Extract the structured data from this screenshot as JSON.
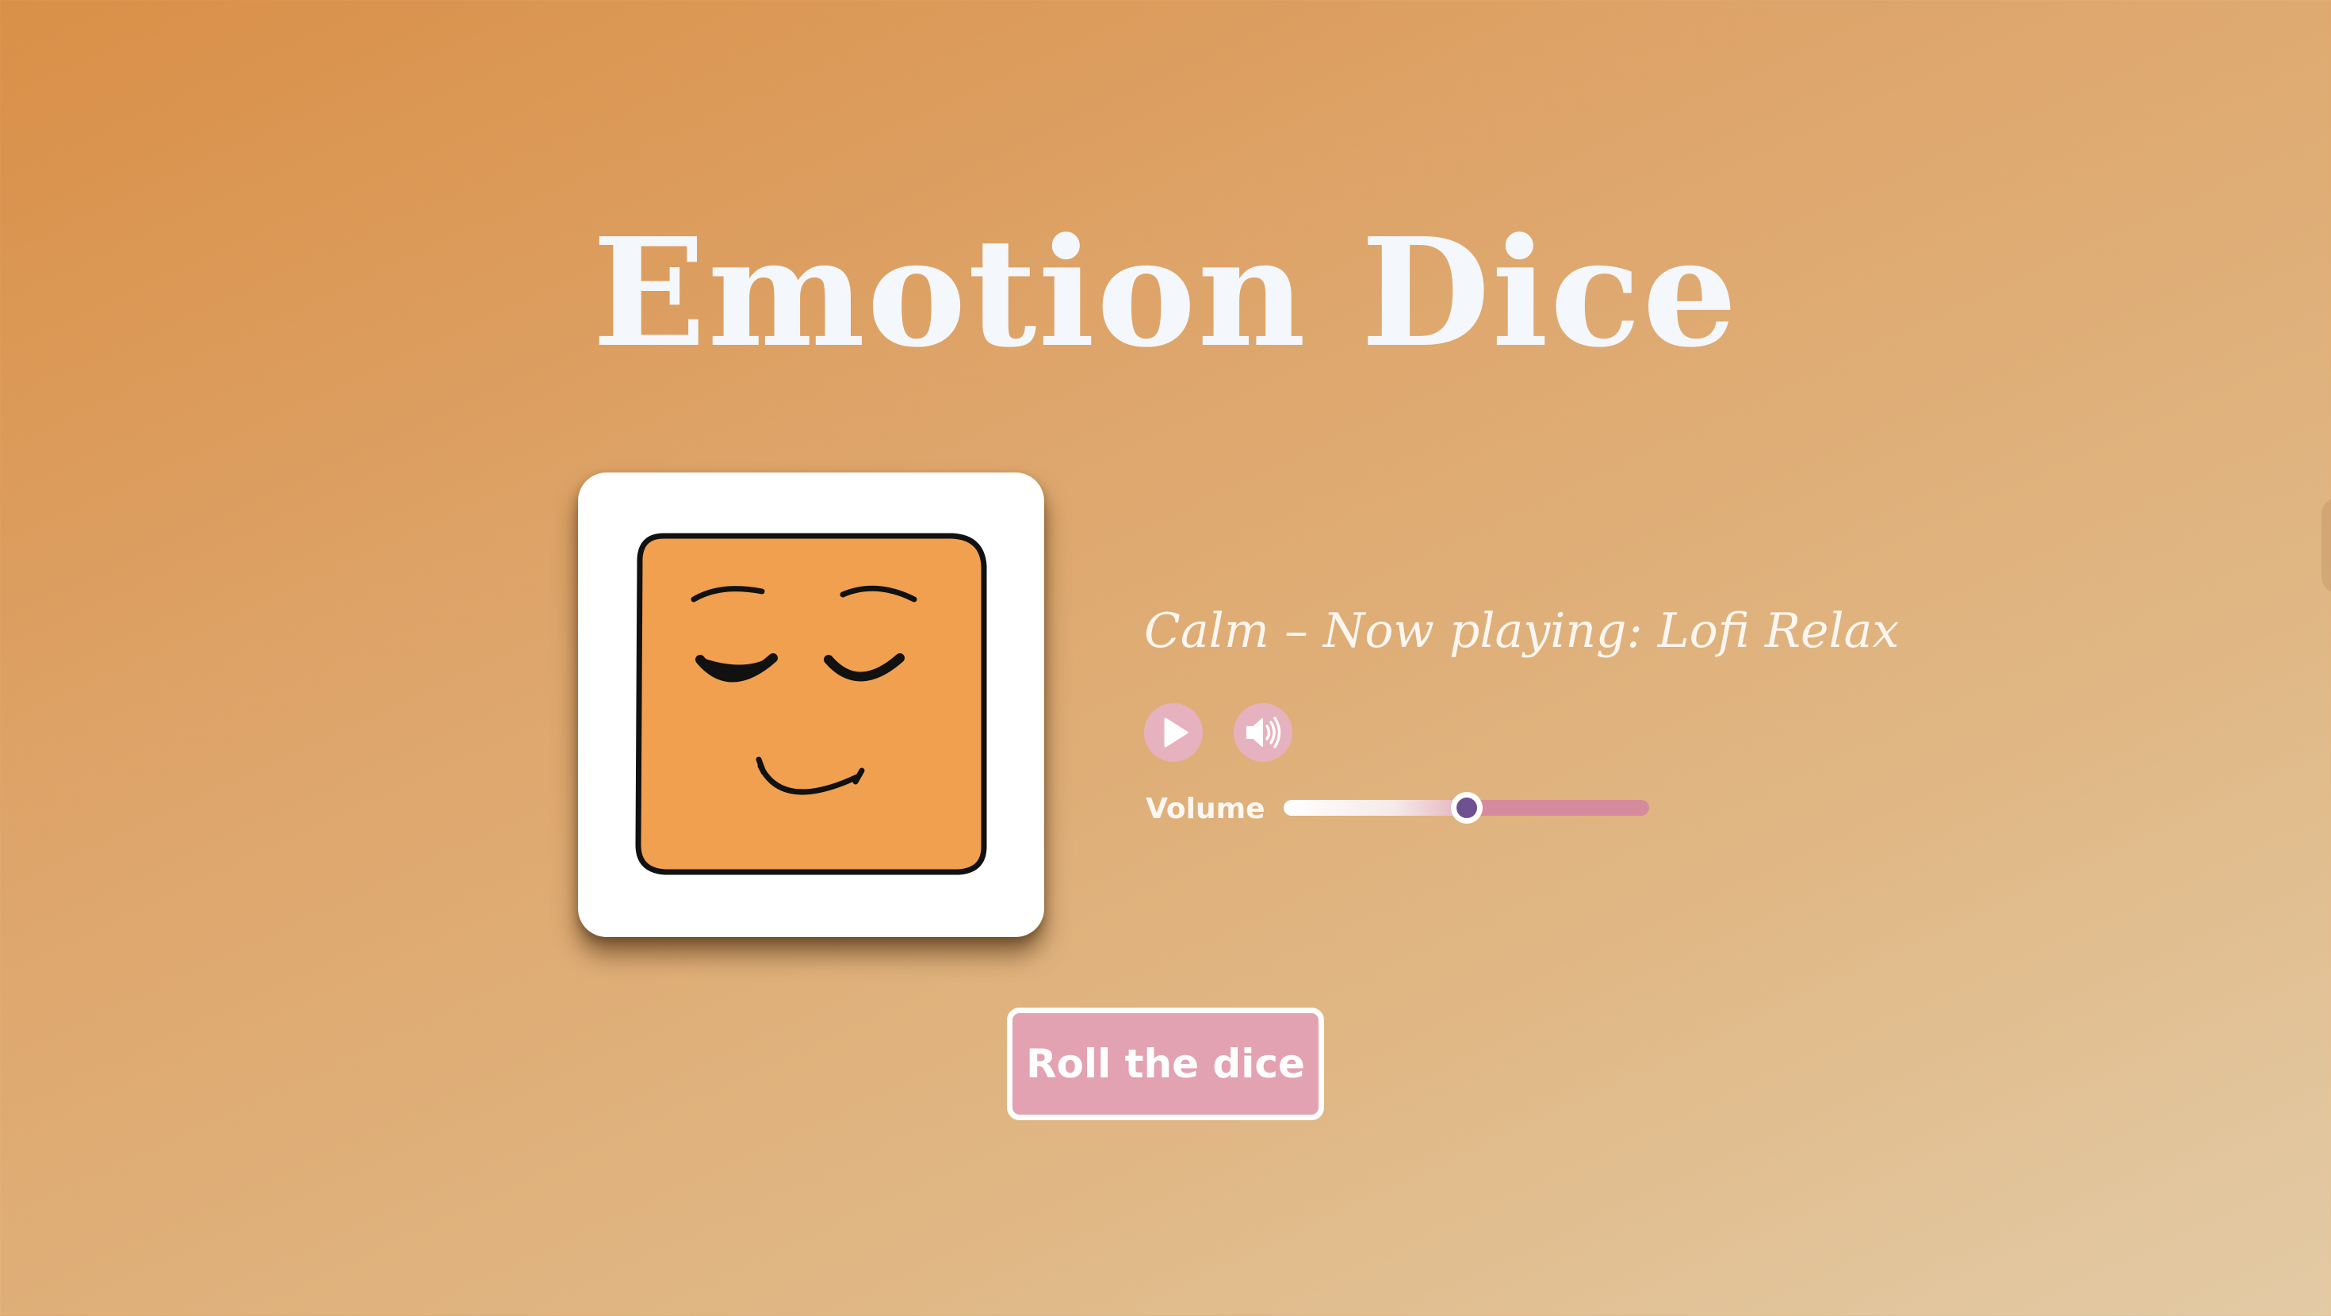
{
  "app": {
    "title": "Emotion Dice"
  },
  "dice": {
    "emotion": "Calm",
    "face_icon": "calm-face-icon",
    "face_color": "#f0a04f"
  },
  "player": {
    "status_text": "Calm – Now playing: Lofi Relax",
    "play_icon": "play-icon",
    "volume_icon": "speaker-icon",
    "volume_label": "Volume",
    "volume_percent": 50
  },
  "actions": {
    "roll_label": "Roll the dice"
  },
  "colors": {
    "background_start": "#d98f47",
    "background_end": "#e3cba6",
    "title": "#f4f7fb",
    "accent_pink": "#e3a2b1",
    "slider_thumb": "#6f5192"
  }
}
